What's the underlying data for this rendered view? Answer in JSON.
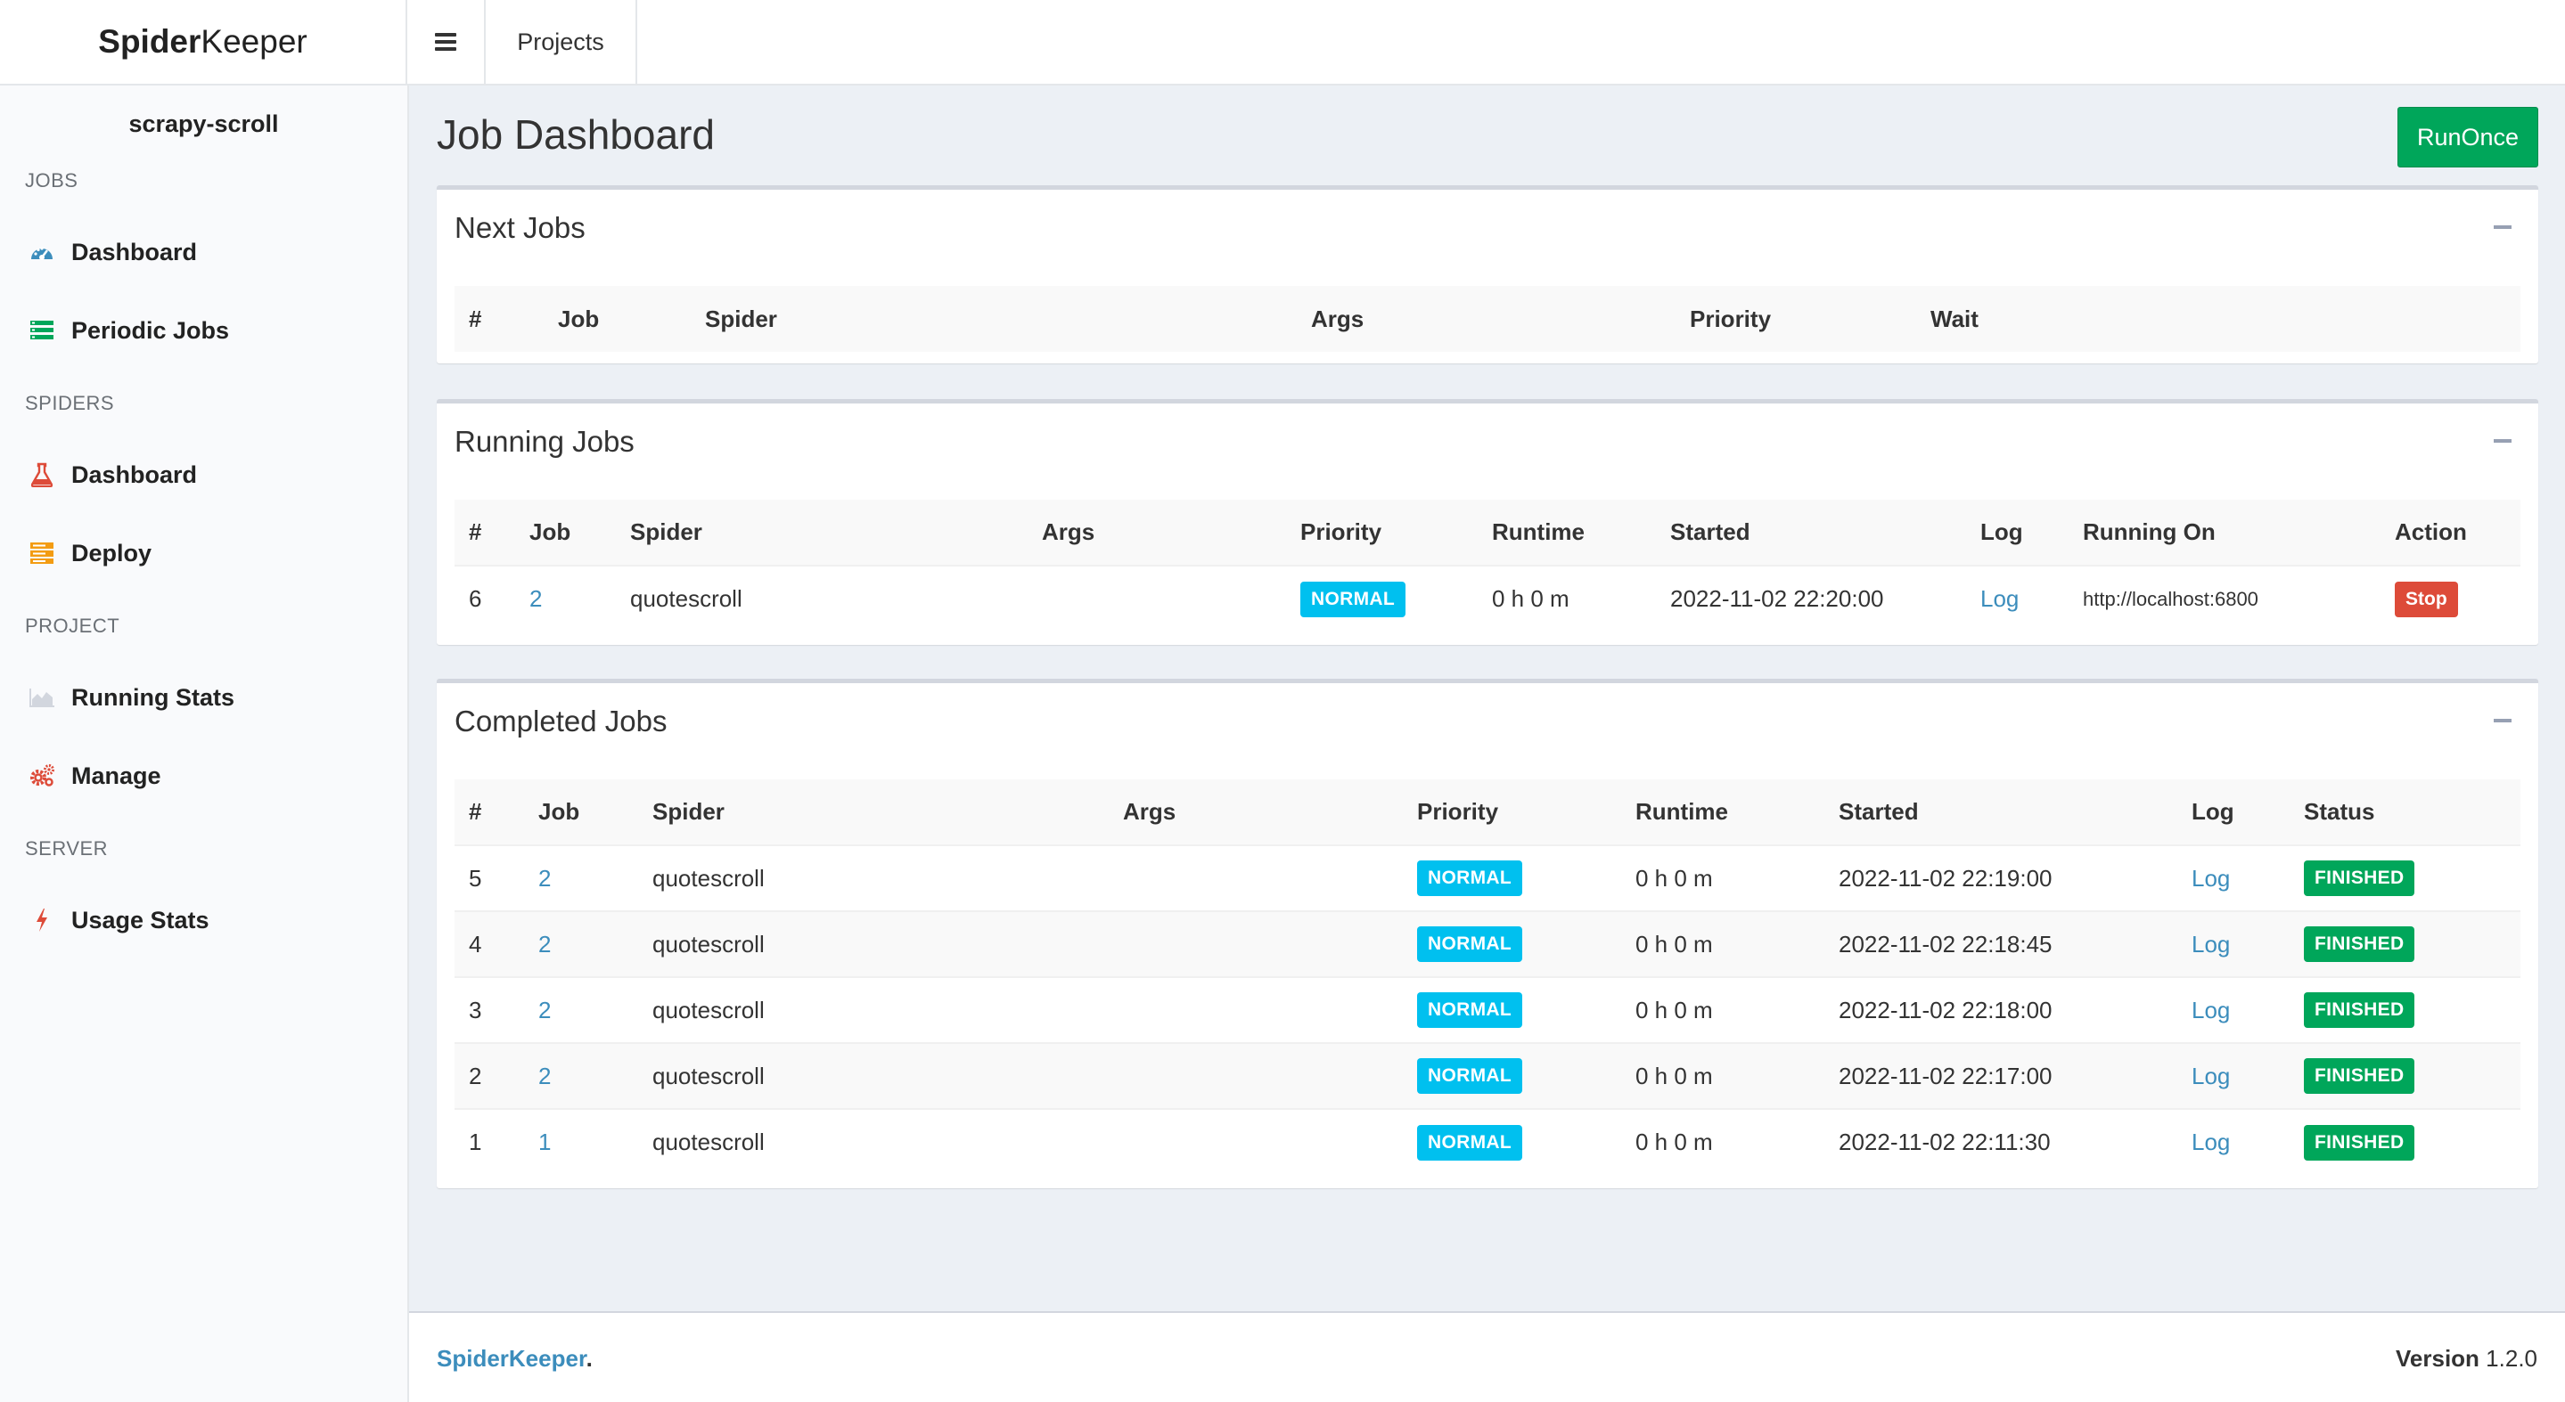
{
  "header": {
    "logo_bold": "Spider",
    "logo_light": "Keeper",
    "menu_icon": "hamburger-icon",
    "projects_label": "Projects"
  },
  "sidebar": {
    "project_name": "scrapy-scroll",
    "sections": {
      "jobs": "JOBS",
      "spiders": "SPIDERS",
      "project": "PROJECT",
      "server": "SERVER"
    },
    "items": [
      {
        "label": "Dashboard",
        "icon": "dashboard-icon",
        "color": "#3c8dbc"
      },
      {
        "label": "Periodic Jobs",
        "icon": "list-icon",
        "color": "#00a65a"
      },
      {
        "label": "Dashboard",
        "icon": "flask-icon",
        "color": "#dd4b39"
      },
      {
        "label": "Deploy",
        "icon": "server-icon",
        "color": "#f39c12"
      },
      {
        "label": "Running Stats",
        "icon": "area-chart-icon",
        "color": "#d2d6de"
      },
      {
        "label": "Manage",
        "icon": "gears-icon",
        "color": "#dd4b39"
      },
      {
        "label": "Usage Stats",
        "icon": "bolt-icon",
        "color": "#dd4b39"
      }
    ]
  },
  "main": {
    "title": "Job Dashboard",
    "run_once_label": "RunOnce",
    "next_jobs": {
      "title": "Next Jobs",
      "columns": [
        "#",
        "Job",
        "Spider",
        "Args",
        "Priority",
        "Wait"
      ]
    },
    "running_jobs": {
      "title": "Running Jobs",
      "columns": [
        "#",
        "Job",
        "Spider",
        "Args",
        "Priority",
        "Runtime",
        "Started",
        "Log",
        "Running On",
        "Action"
      ],
      "rows": [
        {
          "id": "6",
          "job": "2",
          "spider": "quotescroll",
          "args": "",
          "priority": "NORMAL",
          "runtime": "0 h 0 m",
          "started": "2022-11-02 22:20:00",
          "log": "Log",
          "running_on": "http://localhost:6800",
          "action": "Stop"
        }
      ]
    },
    "completed_jobs": {
      "title": "Completed Jobs",
      "columns": [
        "#",
        "Job",
        "Spider",
        "Args",
        "Priority",
        "Runtime",
        "Started",
        "Log",
        "Status"
      ],
      "rows": [
        {
          "id": "5",
          "job": "2",
          "spider": "quotescroll",
          "args": "",
          "priority": "NORMAL",
          "runtime": "0 h 0 m",
          "started": "2022-11-02 22:19:00",
          "log": "Log",
          "status": "FINISHED"
        },
        {
          "id": "4",
          "job": "2",
          "spider": "quotescroll",
          "args": "",
          "priority": "NORMAL",
          "runtime": "0 h 0 m",
          "started": "2022-11-02 22:18:45",
          "log": "Log",
          "status": "FINISHED"
        },
        {
          "id": "3",
          "job": "2",
          "spider": "quotescroll",
          "args": "",
          "priority": "NORMAL",
          "runtime": "0 h 0 m",
          "started": "2022-11-02 22:18:00",
          "log": "Log",
          "status": "FINISHED"
        },
        {
          "id": "2",
          "job": "2",
          "spider": "quotescroll",
          "args": "",
          "priority": "NORMAL",
          "runtime": "0 h 0 m",
          "started": "2022-11-02 22:17:00",
          "log": "Log",
          "status": "FINISHED"
        },
        {
          "id": "1",
          "job": "1",
          "spider": "quotescroll",
          "args": "",
          "priority": "NORMAL",
          "runtime": "0 h 0 m",
          "started": "2022-11-02 22:11:30",
          "log": "Log",
          "status": "FINISHED"
        }
      ]
    }
  },
  "footer": {
    "brand": "SpiderKeeper",
    "brand_dot": ".",
    "version_label": "Version",
    "version_value": "1.2.0"
  },
  "colors": {
    "accent": "#3c8dbc",
    "success": "#00a65a",
    "info": "#00c0ef",
    "danger": "#dd4b39"
  }
}
